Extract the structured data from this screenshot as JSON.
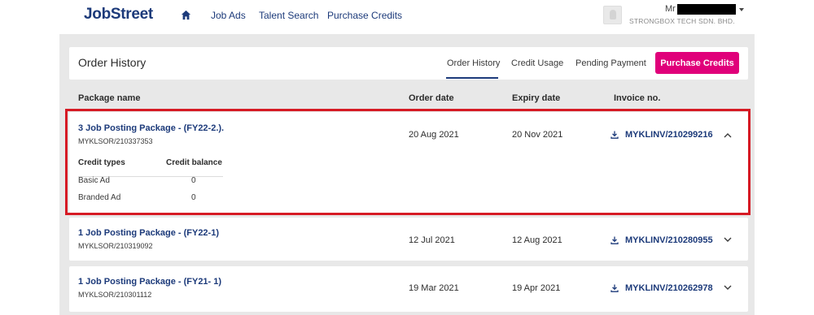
{
  "brand": {
    "logo": "JobStreet",
    "accent": "#e0007a",
    "navy": "#1c3a7a",
    "highlight": "#d61a24"
  },
  "nav": {
    "home_icon": "home-icon",
    "links": [
      "Job Ads",
      "Talent Search",
      "Purchase Credits"
    ]
  },
  "user": {
    "salutation": "Mr",
    "company": "STRONGBOX TECH SDN. BHD."
  },
  "order_history": {
    "title": "Order History",
    "tabs": [
      "Order History",
      "Credit Usage",
      "Pending Payment"
    ],
    "active_tab": "Order History",
    "purchase_button": "Purchase Credits"
  },
  "table": {
    "headers": [
      "Package name",
      "Order date",
      "Expiry date",
      "Invoice no."
    ],
    "rows": [
      {
        "name": "3 Job Posting Package - (FY22-2.).",
        "ref": "MYKLSOR/210337353",
        "order_date": "20 Aug 2021",
        "expiry_date": "20 Nov 2021",
        "invoice": "MYKLINV/210299216",
        "expanded": true,
        "credits": {
          "headers": [
            "Credit types",
            "Credit balance"
          ],
          "items": [
            {
              "type": "Basic Ad",
              "balance": "0"
            },
            {
              "type": "Branded Ad",
              "balance": "0"
            }
          ]
        }
      },
      {
        "name": "1 Job Posting Package - (FY22-1)",
        "ref": "MYKLSOR/210319092",
        "order_date": "12 Jul 2021",
        "expiry_date": "12 Aug 2021",
        "invoice": "MYKLINV/210280955",
        "expanded": false
      },
      {
        "name": "1 Job Posting Package - (FY21- 1)",
        "ref": "MYKLSOR/210301112",
        "order_date": "19 Mar 2021",
        "expiry_date": "19 Apr 2021",
        "invoice": "MYKLINV/210262978",
        "expanded": false
      }
    ]
  }
}
